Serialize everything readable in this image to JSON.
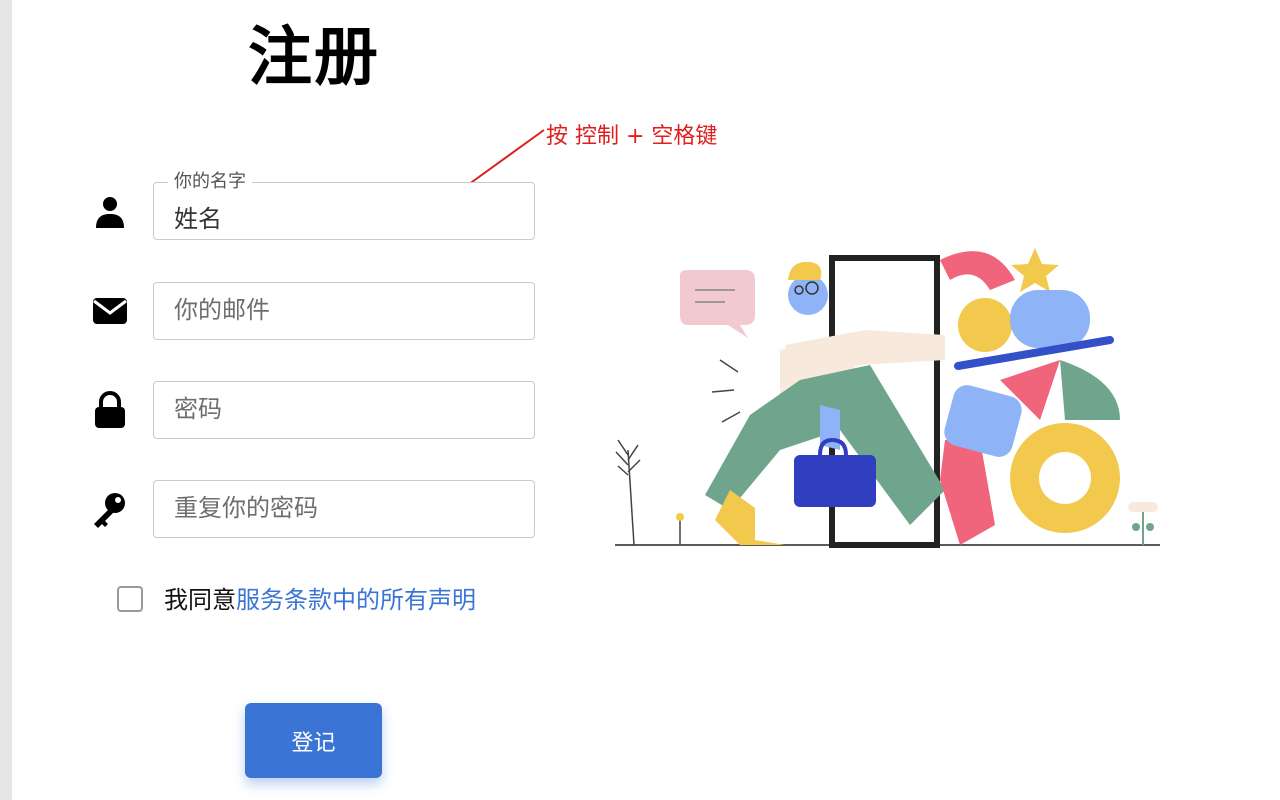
{
  "title": "注册",
  "annotation": {
    "text": "按 控制 + 空格键",
    "color": "#e01e1e"
  },
  "form": {
    "name": {
      "label": "你的名字",
      "value": "姓名",
      "icon": "person-icon"
    },
    "email": {
      "placeholder": "你的邮件",
      "icon": "envelope-icon"
    },
    "password": {
      "placeholder": "密码",
      "icon": "lock-icon"
    },
    "repeat_password": {
      "placeholder": "重复你的密码",
      "icon": "key-icon"
    },
    "agree": {
      "prefix": "我同意",
      "link": "服务条款中的所有声明",
      "checked": false
    },
    "submit_label": "登记"
  },
  "colors": {
    "accent": "#3a75d6",
    "link": "#3a75d6",
    "annotation": "#e01e1e"
  },
  "illustration": {
    "icon": "signup-illustration"
  }
}
